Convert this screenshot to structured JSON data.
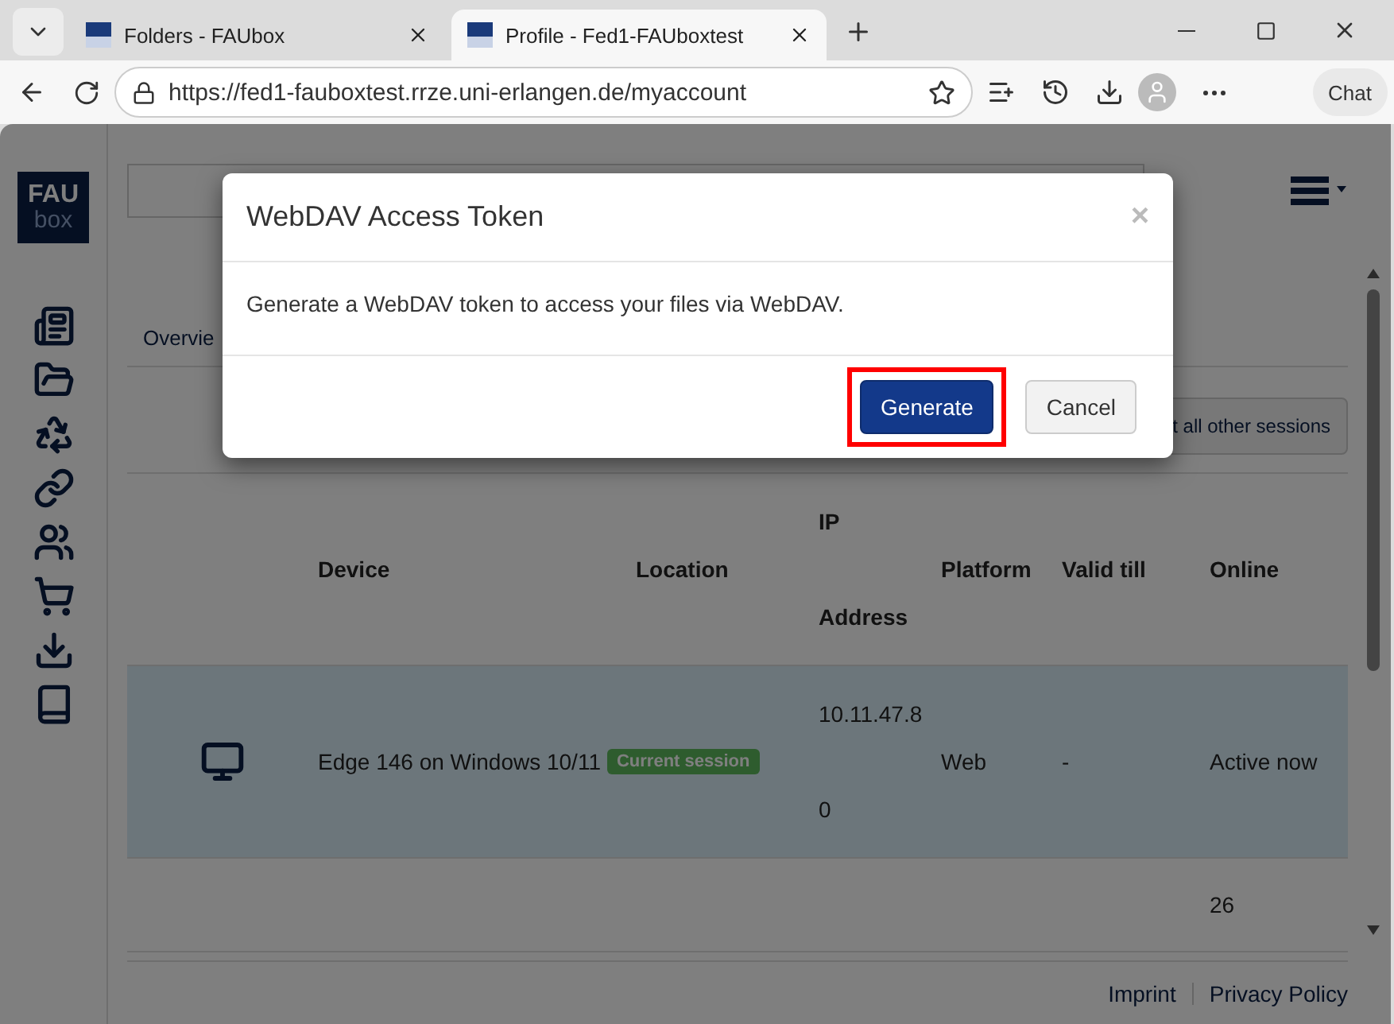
{
  "browser": {
    "tabs": [
      {
        "title": "Folders - FAUbox",
        "selected": false
      },
      {
        "title": "Profile - Fed1-FAUboxtest",
        "selected": true
      }
    ],
    "address": "https://fed1-fauboxtest.rrze.uni-erlangen.de/myaccount",
    "chat_label": "Chat"
  },
  "page": {
    "logo": {
      "line1": "FAU",
      "line2": "box"
    },
    "tabs": [
      {
        "label": "Overvie"
      }
    ],
    "sessions_button": "t all other sessions",
    "table": {
      "columns": [
        "Device",
        "Location",
        "IP Address",
        "Platform",
        "Valid till",
        "Online"
      ],
      "rows": [
        {
          "device": "Edge 146 on Windows 10/11",
          "badge": "Current session",
          "ip": "10.11.47.80",
          "platform": "Web",
          "valid_till": "-",
          "online": "Active now",
          "selected": true
        },
        {
          "online": "26",
          "selected": false
        }
      ]
    },
    "footer": [
      "Imprint",
      "Privacy Policy"
    ]
  },
  "modal": {
    "title": "WebDAV Access Token",
    "close": "×",
    "body": "Generate a WebDAV token to access your files via WebDAV.",
    "buttons": [
      {
        "label": "Generate",
        "kind": "primary",
        "highlighted": true
      },
      {
        "label": "Cancel",
        "kind": "default",
        "highlighted": false
      }
    ]
  }
}
